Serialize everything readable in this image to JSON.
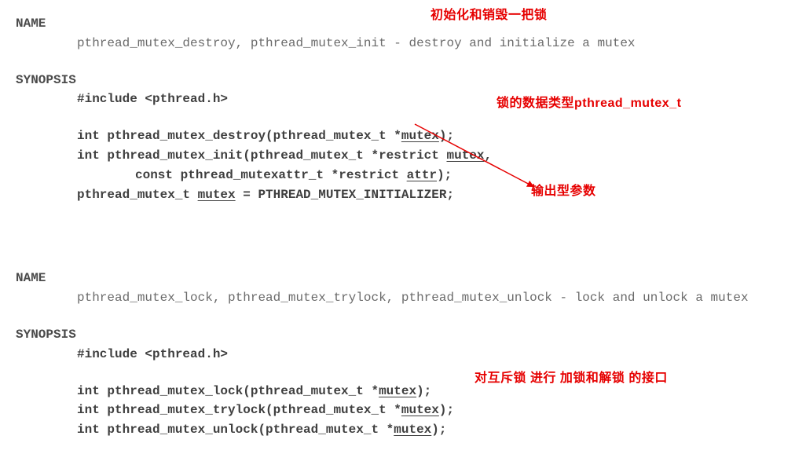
{
  "annot": {
    "a1": "初始化和销毁一把锁",
    "a2": "锁的数据类型pthread_mutex_t",
    "a3": "输出型参数",
    "a4": "对互斥锁 进行 加锁和解锁 的接口"
  },
  "labels": {
    "name": "NAME",
    "synopsis": "SYNOPSIS"
  },
  "s1": {
    "desc_a": "pthread_mutex_destroy, pthread_mutex_init - destroy and initialize a mutex",
    "include": "#include <pthread.h>",
    "l1_a": "int pthread_mutex_destroy(pthread_mutex_t *",
    "l1_u": "mutex",
    "l1_b": ");",
    "l2_a": "int pthread_mutex_init(pthread_mutex_t *restrict ",
    "l2_u": "mutex",
    "l2_b": ",",
    "l3_a": "const pthread_mutexattr_t *restrict ",
    "l3_u": "attr",
    "l3_b": ");",
    "l4_a": "pthread_mutex_t ",
    "l4_u": "mutex",
    "l4_b": " = PTHREAD_MUTEX_INITIALIZER;"
  },
  "s2": {
    "desc_a": "pthread_mutex_lock, pthread_mutex_trylock, pthread_mutex_unlock - lock and unlock a mutex",
    "include": "#include <pthread.h>",
    "l1_a": "int pthread_mutex_lock(pthread_mutex_t *",
    "l1_u": "mutex",
    "l1_b": ");",
    "l2_a": "int pthread_mutex_trylock(pthread_mutex_t *",
    "l2_u": "mutex",
    "l2_b": ");",
    "l3_a": "int pthread_mutex_unlock(pthread_mutex_t *",
    "l3_u": "mutex",
    "l3_b": ");"
  }
}
